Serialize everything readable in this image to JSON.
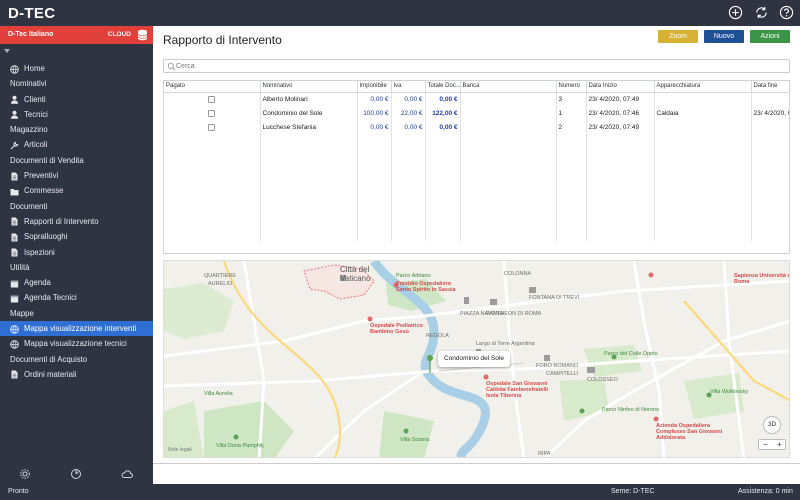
{
  "app": {
    "title": "D-TEC",
    "top_icons": [
      "plus-circle-icon",
      "refresh-icon",
      "help-icon"
    ]
  },
  "company": {
    "name": "D-Tec Italiano",
    "badge": "CLOUD"
  },
  "sidebar": {
    "rows": [
      {
        "type": "item",
        "label": "Home",
        "icon": "globe-icon"
      },
      {
        "type": "section",
        "label": "Nominativi"
      },
      {
        "type": "item",
        "label": "Clienti",
        "icon": "person-icon"
      },
      {
        "type": "item",
        "label": "Tecnici",
        "icon": "person-icon"
      },
      {
        "type": "section",
        "label": "Magazzino"
      },
      {
        "type": "item",
        "label": "Articoli",
        "icon": "wrench-icon"
      },
      {
        "type": "section",
        "label": "Documenti di Vendita"
      },
      {
        "type": "item",
        "label": "Preventivi",
        "icon": "document-icon"
      },
      {
        "type": "item",
        "label": "Commesse",
        "icon": "folder-icon"
      },
      {
        "type": "section",
        "label": "Documenti"
      },
      {
        "type": "item",
        "label": "Rapporti di Intervento",
        "icon": "document-icon"
      },
      {
        "type": "item",
        "label": "Sopralluoghi",
        "icon": "document-icon"
      },
      {
        "type": "item",
        "label": "Ispezioni",
        "icon": "document-icon"
      },
      {
        "type": "section",
        "label": "Utilità"
      },
      {
        "type": "item",
        "label": "Agenda",
        "icon": "calendar-icon"
      },
      {
        "type": "item",
        "label": "Agenda Tecnici",
        "icon": "calendar-icon"
      },
      {
        "type": "section",
        "label": "Mappe"
      },
      {
        "type": "item",
        "label": "Mappa visualizzazione interventi",
        "icon": "globe-icon",
        "active": true
      },
      {
        "type": "item",
        "label": "Mappa visualizzazione tecnici",
        "icon": "globe-icon"
      },
      {
        "type": "section",
        "label": "Documenti di Acquisto"
      },
      {
        "type": "item",
        "label": "Ordini materiali",
        "icon": "document-icon"
      }
    ],
    "bottom_icons": [
      "gear-icon",
      "dashboard-icon",
      "cloud-icon"
    ]
  },
  "page": {
    "title": "Rapporto di Intervento",
    "buttons": {
      "zoom": "Zoom",
      "new": "Nuovo",
      "actions": "Azioni"
    },
    "search_placeholder": "Cerca"
  },
  "table": {
    "columns": [
      "Pagato",
      "Nominativo",
      "Imponibile",
      "Iva",
      "Totale Doc...",
      "Banca",
      "Numero",
      "Data Inizio",
      "Apparecchiatura",
      "Data fine"
    ],
    "rows": [
      {
        "nominativo": "Alberto Molinari",
        "imponibile": "0,00 €",
        "iva": "0,00 €",
        "totale": "0,00 €",
        "banca": "",
        "numero": "3",
        "data_inizio": "23/ 4/2020, 07:49",
        "apparecchiatura": "",
        "data_fine": ""
      },
      {
        "nominativo": "Condominio del Sole",
        "imponibile": "100,00 €",
        "iva": "22,00 €",
        "totale": "122,00 €",
        "banca": "",
        "numero": "1",
        "data_inizio": "23/ 4/2020, 07:46",
        "apparecchiatura": "Caldaia",
        "data_fine": "23/ 4/2020, 07:4"
      },
      {
        "nominativo": "Lucchese Stefania",
        "imponibile": "0,00 €",
        "iva": "0,00 €",
        "totale": "0,00 €",
        "banca": "",
        "numero": "2",
        "data_inizio": "23/ 4/2020, 07:49",
        "apparecchiatura": "",
        "data_fine": ""
      }
    ]
  },
  "map": {
    "callout": "Condominio del Sole",
    "button_3d": "3D",
    "zoom_out": "−",
    "zoom_in": "+",
    "legal": "Note legali",
    "labels": [
      {
        "text": "Città del",
        "style": "big"
      },
      {
        "text": "Vaticano",
        "style": "big"
      },
      {
        "text": "QUARTIERE",
        "style": ""
      },
      {
        "text": "AURELIO",
        "style": ""
      },
      {
        "text": "Presidio Ospedaliero Santo Spirito in Sassia",
        "style": "red"
      },
      {
        "text": "Ospedale Pediatrico Bambino Gesù",
        "style": "red"
      },
      {
        "text": "Parco Adriano",
        "style": "green"
      },
      {
        "text": "PIAZZA NAVONA",
        "style": ""
      },
      {
        "text": "PANTHEON DI ROMA",
        "style": ""
      },
      {
        "text": "FONTANA DI TREVI",
        "style": ""
      },
      {
        "text": "COLONNA",
        "style": ""
      },
      {
        "text": "REGOLA",
        "style": ""
      },
      {
        "text": "Largo di Torre Argentina",
        "style": ""
      },
      {
        "text": "Ospedale San Giovanni Calibita Fatebenefratelli Isola Tiberina",
        "style": "red"
      },
      {
        "text": "FORO ROMANO",
        "style": ""
      },
      {
        "text": "CAMPITELLI",
        "style": ""
      },
      {
        "text": "COLOSSEO",
        "style": ""
      },
      {
        "text": "Parco del Colle Oppio",
        "style": "green"
      },
      {
        "text": "Parco Ninfeo di Nerone",
        "style": "green"
      },
      {
        "text": "Villa Wolkonsky",
        "style": "green"
      },
      {
        "text": "Sapienza Università di Roma",
        "style": "red"
      },
      {
        "text": "Azienda Ospedaliera Complesso San Giovanni Addolorata",
        "style": "red"
      },
      {
        "text": "Villa Doria Pamphilj",
        "style": "green"
      },
      {
        "text": "Villa Sciarra",
        "style": "green"
      },
      {
        "text": "RIPA",
        "style": ""
      },
      {
        "text": "Villa Aurelia",
        "style": "green"
      }
    ]
  },
  "status": {
    "left": "Pronto",
    "center": "Seme: D-TEC",
    "right": "Assistenza: 0 min"
  },
  "colors": {
    "accent": "#2f6fd3",
    "sidebar": "#2e3442",
    "brand_red": "#e2403a",
    "zoom": "#d6b133",
    "new": "#1f4f95",
    "actions": "#3b9448"
  }
}
